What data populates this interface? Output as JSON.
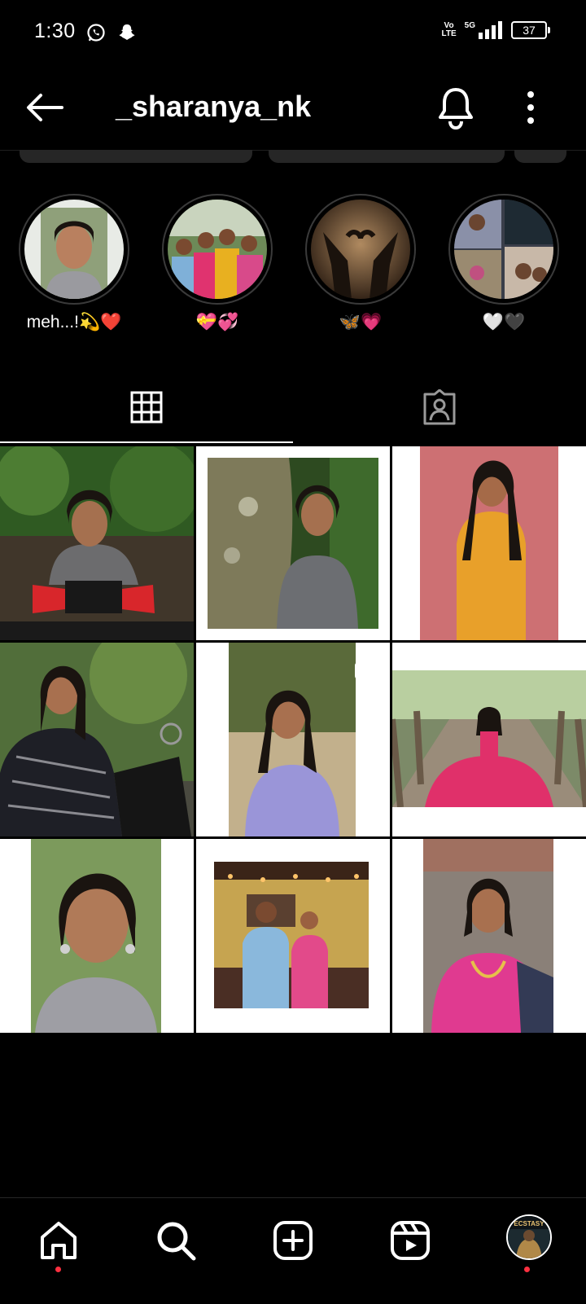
{
  "status_bar": {
    "time": "1:30",
    "volte_top": "Vo",
    "volte_bottom": "LTE",
    "network": "5G",
    "battery": "37"
  },
  "header": {
    "username": "_sharanya_nk"
  },
  "highlights": [
    {
      "label": "meh...!💫❤️"
    },
    {
      "label": "💝💞"
    },
    {
      "label": "🦋💗"
    },
    {
      "label": "🤍🖤"
    }
  ],
  "colors": {
    "background": "#000000",
    "notification_dot": "#ff3040",
    "divider": "#262626"
  },
  "icons": {
    "tab_posts": "grid-icon",
    "tab_tagged": "tagged-user-icon",
    "nav": [
      "home-icon",
      "search-icon",
      "create-icon",
      "reels-icon",
      "profile-avatar"
    ]
  },
  "avatar_text": "ECSTASY"
}
